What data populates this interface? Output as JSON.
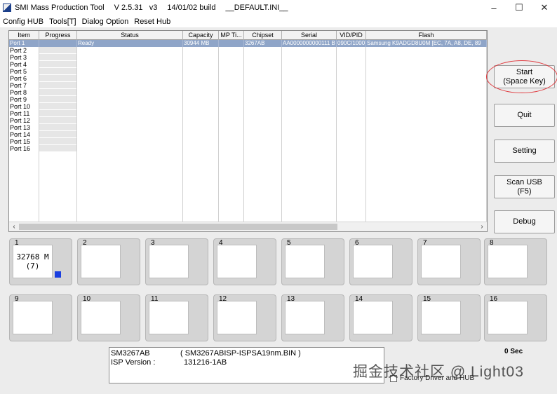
{
  "titlebar": {
    "app_name": "SMI Mass Production Tool",
    "version": "V 2.5.31   v3",
    "build": "14/01/02 build",
    "ini": "__DEFAULT.INI__",
    "minimize": "–",
    "maximize": "☐",
    "close": "✕"
  },
  "menu": [
    "Config HUB",
    "Tools[T]",
    "Dialog Option",
    "Reset Hub"
  ],
  "grid": {
    "columns": [
      "Item",
      "Progress",
      "Status",
      "Capacity",
      "MP Ti...",
      "Chipset",
      "Serial",
      "VID/PID",
      "Flash"
    ],
    "ports": [
      "Port 1",
      "Port 2",
      "Port 3",
      "Port 4",
      "Port 5",
      "Port 6",
      "Port 7",
      "Port 8",
      "Port 9",
      "Port 10",
      "Port 11",
      "Port 12",
      "Port 13",
      "Port 14",
      "Port 15",
      "Port 16"
    ],
    "selected_row": {
      "status": "Ready",
      "capacity": "30944 MB",
      "chipset": "3267AB",
      "serial": "AA0000000000111 B",
      "vidpid": "090C/1000",
      "flash": "Samsung K9ADGD8U0M [EC, 7A, A8, DE, 89"
    },
    "scroll_left": "‹",
    "scroll_right": "›"
  },
  "buttons": {
    "start_line1": "Start",
    "start_line2": "(Space Key)",
    "quit": "Quit",
    "setting": "Setting",
    "scan_line1": "Scan USB",
    "scan_line2": "(F5)",
    "debug": "Debug"
  },
  "port_boxes": {
    "labels": [
      "1",
      "2",
      "3",
      "4",
      "5",
      "6",
      "7",
      "8",
      "9",
      "10",
      "11",
      "12",
      "13",
      "14",
      "15",
      "16"
    ],
    "port1_cap_line1": "32768 M",
    "port1_cap_line2": "(7)",
    "indicator_color": "#1a3fe0"
  },
  "info": {
    "chip": "SM3267AB",
    "bin": "( SM3267ABISP-ISPSA19nm.BIN )",
    "isp_label": "ISP Version :",
    "isp_value": "131216-1AB"
  },
  "timer": "0 Sec",
  "factory_option": "Factory Driver and HUB",
  "watermark": "掘金技术社区 @ Light03",
  "colors": {
    "selection": "#8fa5c8",
    "annotation_circle": "#e0393e"
  }
}
